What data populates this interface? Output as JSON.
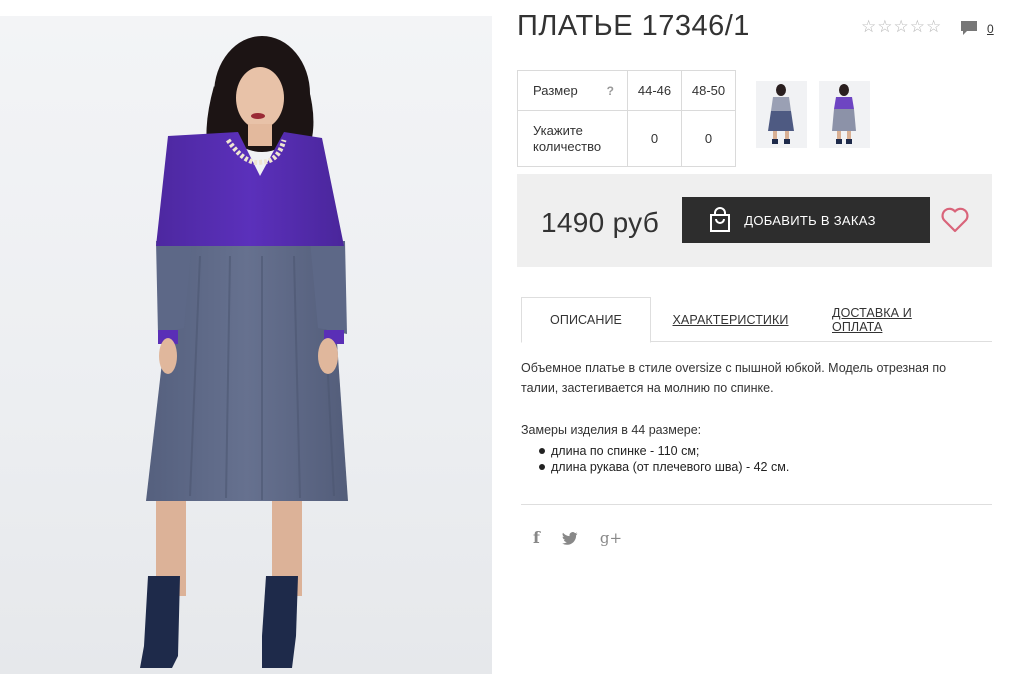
{
  "product": {
    "title": "ПЛАТЬЕ 17346/1",
    "rating_stars": 5,
    "comments_count": "0"
  },
  "photo": {
    "icon": "dress-model-photo"
  },
  "size_table": {
    "size_label": "Размер",
    "help_label": "?",
    "quantity_label": "Укажите количество",
    "sizes": [
      "44-46",
      "48-50"
    ],
    "quantities": [
      "0",
      "0"
    ]
  },
  "thumbnails": [
    {
      "icon": "product-thumbnail-front"
    },
    {
      "icon": "product-thumbnail-side"
    }
  ],
  "purchase": {
    "price": "1490 руб",
    "order_button": "ДОБАВИТЬ В ЗАКАЗ",
    "wishlist_icon": "heart-icon"
  },
  "tabs": [
    "ОПИСАНИЕ",
    "ХАРАКТЕРИСТИКИ",
    "ДОСТАВКА И ОПЛАТА"
  ],
  "description": {
    "text": "Объемное платье в стиле oversize с пышной юбкой. Модель отрезная по талии, застегивается на молнию по спинке.",
    "measures_title": "Замеры изделия в 44 размере:",
    "measures": [
      "длина по спинке - 110 см;",
      "длина рукава (от плечевого шва) - 42 см."
    ]
  },
  "social": {
    "facebook": "f",
    "google": "g+"
  },
  "colors": {
    "dress_top": "#5a2fb6",
    "dress_skirt": "#5f6a8a",
    "button": "#2d2d2d",
    "heart": "#d9647a"
  }
}
